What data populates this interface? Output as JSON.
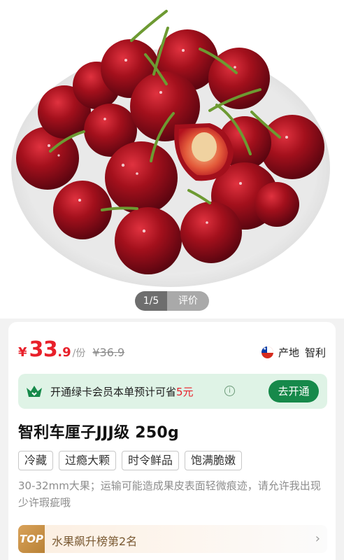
{
  "gallery": {
    "index": "1/5",
    "review_tab": "评价",
    "image_subject": "cherries-in-white-bowl"
  },
  "price": {
    "currency": "¥",
    "integer": "33",
    "decimal": ".9",
    "unit": "/份",
    "original": "¥36.9"
  },
  "origin": {
    "label": "产地",
    "country": "智利",
    "flag_icon": "chile-flag-icon"
  },
  "membership": {
    "text_before": "开通绿卡会员本单预计可省",
    "amount": "5元",
    "info": "i",
    "button": "去开通",
    "accent": "#16894a",
    "background": "#dff3e6"
  },
  "product": {
    "title": "智利车厘子JJJ级 250g",
    "tags": [
      "冷藏",
      "过瘾大颗",
      "时令鲜品",
      "饱满脆嫩"
    ],
    "description": "30-32mm大果；运输可能造成果皮表面轻微痕迹，请允许我出现少许瑕疵哦"
  },
  "ranking": {
    "badge": "TOP",
    "text_before": "水果飙升榜第",
    "rank_number": "2",
    "text_after": "名",
    "chevron": "›"
  },
  "colors": {
    "price_red": "#e8202a",
    "gold": "#c08a40"
  }
}
